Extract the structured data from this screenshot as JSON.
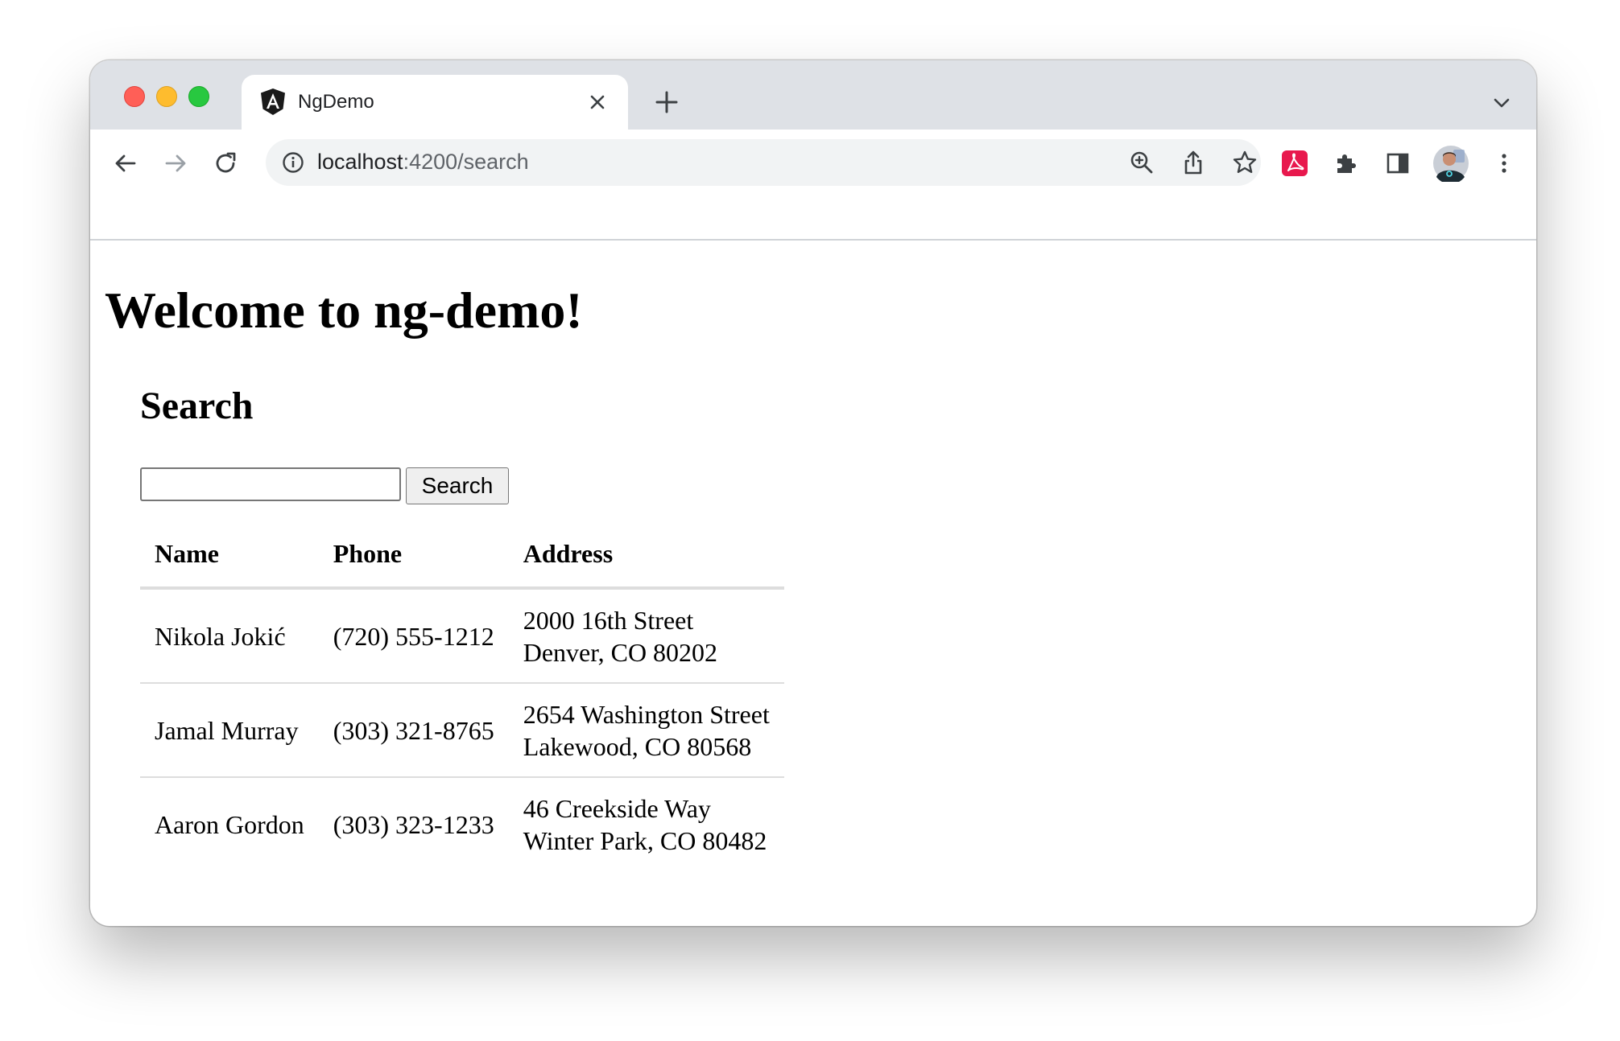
{
  "browser": {
    "tab": {
      "title": "NgDemo",
      "favicon": "angular-logo-icon"
    },
    "address_bar": {
      "host": "localhost",
      "path": ":4200/search"
    },
    "toolbar_icons": [
      "back-icon",
      "forward-icon",
      "reload-icon",
      "site-info-icon",
      "zoom-icon",
      "share-icon",
      "bookmark-star-icon",
      "acrobat-extension-icon",
      "extensions-puzzle-icon",
      "side-panel-icon",
      "profile-avatar",
      "more-menu-icon"
    ],
    "colors": {
      "tabstrip": "#dee1e6",
      "omnibox": "#f1f3f4",
      "extension_accent": "#e8184d"
    }
  },
  "page": {
    "heading": "Welcome to ng-demo!",
    "search": {
      "title": "Search",
      "input_value": "",
      "button_label": "Search"
    },
    "table": {
      "headers": {
        "name": "Name",
        "phone": "Phone",
        "address": "Address"
      },
      "rows": [
        {
          "name": "Nikola Jokić",
          "phone": "(720) 555-1212",
          "street": "2000 16th Street",
          "city": "Denver, CO 80202"
        },
        {
          "name": "Jamal Murray",
          "phone": "(303) 321-8765",
          "street": "2654 Washington Street",
          "city": "Lakewood, CO 80568"
        },
        {
          "name": "Aaron Gordon",
          "phone": "(303) 323-1233",
          "street": "46 Creekside Way",
          "city": "Winter Park, CO 80482"
        }
      ]
    }
  }
}
